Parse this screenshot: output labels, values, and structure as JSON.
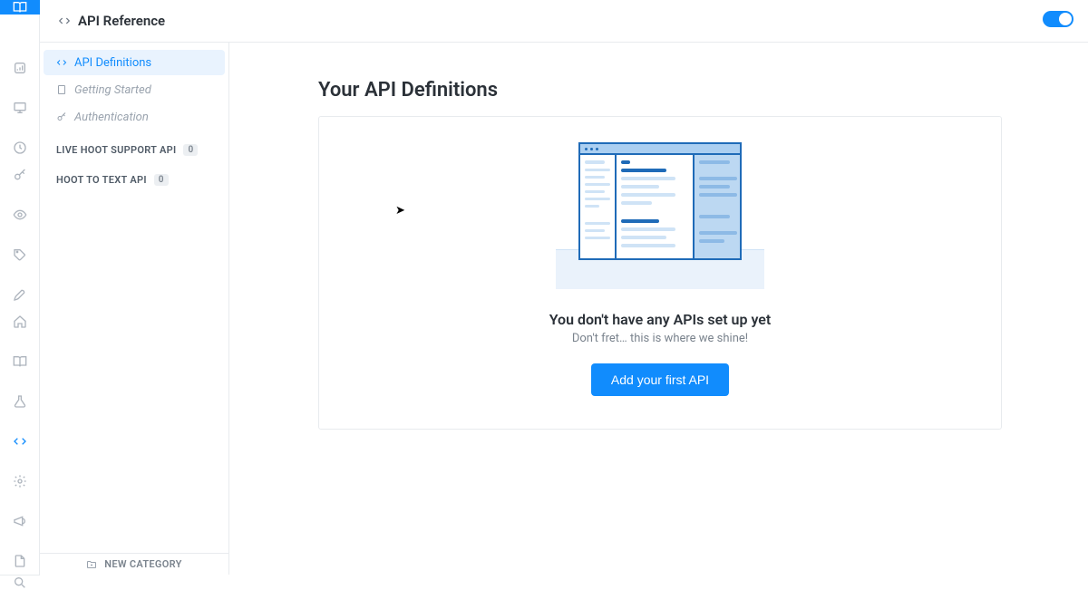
{
  "header": {
    "title": "API Reference"
  },
  "toggle": {
    "on": true
  },
  "sidebar": {
    "links": [
      {
        "label": "API Definitions",
        "icon": "code",
        "active": true
      },
      {
        "label": "Getting Started",
        "icon": "page",
        "italic": true
      },
      {
        "label": "Authentication",
        "icon": "key",
        "italic": true
      }
    ],
    "categories": [
      {
        "label": "LIVE HOOT SUPPORT API",
        "count": "0"
      },
      {
        "label": "HOOT TO TEXT API",
        "count": "0"
      }
    ],
    "footer": "NEW CATEGORY"
  },
  "main": {
    "heading": "Your API Definitions",
    "empty_title": "You don't have any APIs set up yet",
    "empty_sub": "Don't fret… this is where we shine!",
    "cta": "Add your first API"
  }
}
